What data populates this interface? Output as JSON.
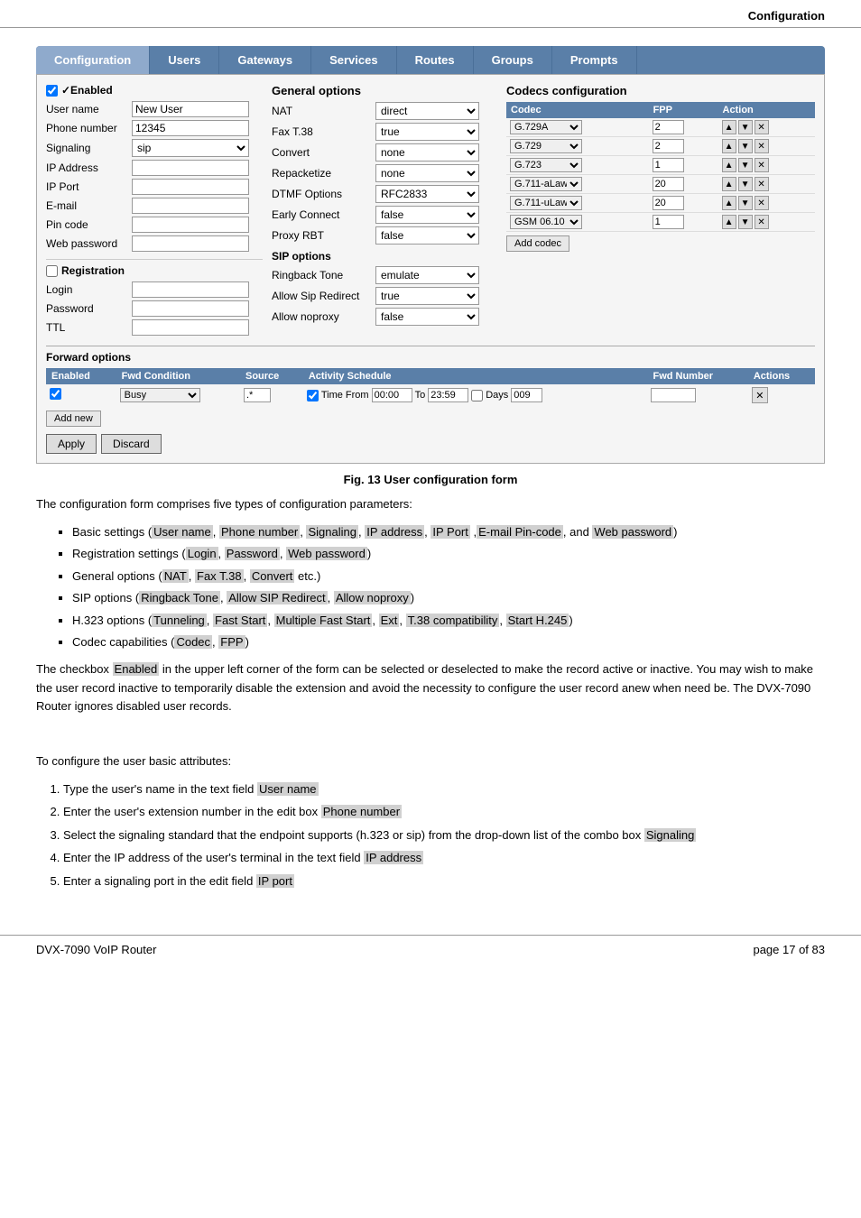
{
  "header": {
    "title": "Configuration"
  },
  "nav": {
    "tabs": [
      {
        "id": "configuration",
        "label": "Configuration",
        "active": true
      },
      {
        "id": "users",
        "label": "Users",
        "active": false
      },
      {
        "id": "gateways",
        "label": "Gateways",
        "active": false
      },
      {
        "id": "services",
        "label": "Services",
        "active": false
      },
      {
        "id": "routes",
        "label": "Routes",
        "active": false
      },
      {
        "id": "groups",
        "label": "Groups",
        "active": false
      },
      {
        "id": "prompts",
        "label": "Prompts",
        "active": false
      }
    ]
  },
  "form": {
    "enabled_label": "✓Enabled",
    "user_name_label": "User name",
    "user_name_value": "New User",
    "phone_number_label": "Phone number",
    "phone_number_value": "12345",
    "signaling_label": "Signaling",
    "signaling_value": "sip",
    "ip_address_label": "IP Address",
    "ip_port_label": "IP Port",
    "email_label": "E-mail",
    "pin_code_label": "Pin code",
    "web_password_label": "Web password",
    "registration_label": "Registration",
    "login_label": "Login",
    "password_label": "Password",
    "ttl_label": "TTL",
    "general_options_title": "General options",
    "nat_label": "NAT",
    "nat_value": "direct",
    "fax_t38_label": "Fax T.38",
    "fax_t38_value": "true",
    "convert_label": "Convert",
    "convert_value": "none",
    "repacketize_label": "Repacketize",
    "repacketize_value": "none",
    "dtmf_label": "DTMF Options",
    "dtmf_value": "RFC2833",
    "early_connect_label": "Early Connect",
    "early_connect_value": "false",
    "proxy_rbt_label": "Proxy RBT",
    "proxy_rbt_value": "false",
    "sip_options_title": "SIP options",
    "ringback_tone_label": "Ringback Tone",
    "ringback_tone_value": "emulate",
    "allow_sip_redirect_label": "Allow Sip Redirect",
    "allow_sip_redirect_value": "true",
    "allow_noproxy_label": "Allow noproxy",
    "allow_noproxy_value": "false",
    "codecs_title": "Codecs configuration",
    "codecs": [
      {
        "name": "G.729A",
        "fpp": "2"
      },
      {
        "name": "G.729",
        "fpp": "2"
      },
      {
        "name": "G.723",
        "fpp": "1"
      },
      {
        "name": "G.711-aLaw",
        "fpp": "20"
      },
      {
        "name": "G.711-uLaw",
        "fpp": "20"
      },
      {
        "name": "GSM 06.10",
        "fpp": "1"
      }
    ],
    "codec_col_codec": "Codec",
    "codec_col_fpp": "FPP",
    "codec_col_action": "Action",
    "add_codec_label": "Add codec",
    "forward_options_title": "Forward options",
    "forward_col_enabled": "Enabled",
    "forward_col_fwd_condition": "Fwd Condition",
    "forward_col_source": "Source",
    "forward_col_activity_schedule": "Activity Schedule",
    "forward_col_fwd_number": "Fwd Number",
    "forward_col_actions": "Actions",
    "forward_row": {
      "enabled": true,
      "condition": "Busy",
      "source": ".*",
      "time_from": "00:00",
      "time_to": "23:59",
      "days": "009",
      "fwd_number": ""
    },
    "add_new_label": "Add new",
    "apply_label": "Apply",
    "discard_label": "Discard"
  },
  "figure_caption": "Fig. 13 User configuration form",
  "body_paragraphs": {
    "intro": "The configuration form comprises five types of configuration parameters:",
    "bullets": [
      "Basic settings (User name, Phone number, Signaling, IP address, IP Port ,E-mail Pin-code, and Web password)",
      "Registration settings (Login, Password, Web password)",
      "General options (NAT, Fax T.38, Convert etc.)",
      "SIP options (Ringback Tone, Allow SIP Redirect, Allow noproxy)",
      "H.323 options (Tunneling, Fast Start, Multiple Fast Start, Ext, T.38 compatibility, Start H.245)",
      "Codec capabilities (Codec, FPP)"
    ],
    "paragraph1": "The checkbox Enabled in the upper left corner of the form can be selected or deselected to make the record active or inactive. You may wish to make the user record inactive to temporarily disable the extension and avoid the necessity to configure the user record anew when need be. The DVX-7090 Router ignores disabled user records.",
    "paragraph2": "To configure the user basic attributes:",
    "numbered": [
      "Type the user's name in the text field User name",
      "Enter the user's extension number in the edit box Phone number",
      "Select the signaling standard that the endpoint supports (h.323 or sip) from the drop-down list of the combo box Signaling",
      "Enter the IP address of the user's terminal in the text field IP address",
      "Enter a signaling port in the edit field IP port"
    ]
  },
  "footer": {
    "left": "DVX-7090 VoIP Router",
    "right": "page 17 of 83"
  }
}
